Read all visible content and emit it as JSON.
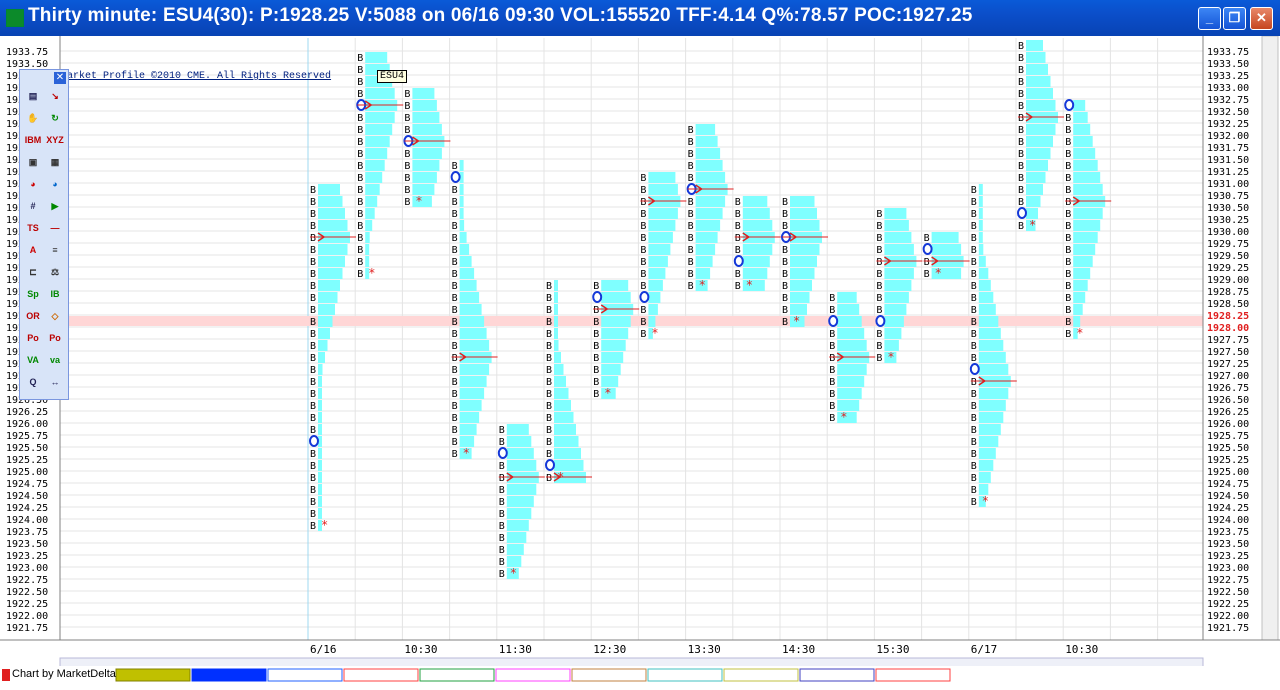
{
  "window": {
    "title": "Thirty minute: ESU4(30): P:1928.25 V:5088 on 06/16 09:30 VOL:155520 TFF:4.14 Q%:78.57 POC:1927.25",
    "min_glyph": "_",
    "max_glyph": "❐",
    "close_glyph": "✕"
  },
  "chart": {
    "copyright": "arket Profile ©2010 CME. All Rights Reserved",
    "symbol": "ESU4",
    "status": "Chart by MarketDelta",
    "toolbox_close": "✕",
    "last_price_label": "1928.25",
    "highlight_price_label": "1928.00"
  },
  "chart_data": {
    "type": "market-profile",
    "letter": "B",
    "price_labels": [
      "1933.75",
      "1933.50",
      "1933.25",
      "1933.00",
      "1932.75",
      "1932.50",
      "1932.25",
      "1932.00",
      "1931.75",
      "1931.50",
      "1931.25",
      "1931.00",
      "1930.75",
      "1930.50",
      "1930.25",
      "1930.00",
      "1929.75",
      "1929.50",
      "1929.25",
      "1929.00",
      "1928.75",
      "1928.50",
      "1928.25",
      "1928.00",
      "1927.75",
      "1927.50",
      "1927.25",
      "1927.00",
      "1926.75",
      "1926.50",
      "1926.25",
      "1926.00",
      "1925.75",
      "1925.50",
      "1925.25",
      "1925.00",
      "1924.75",
      "1924.50",
      "1924.25",
      "1924.00",
      "1923.75",
      "1923.50",
      "1923.25",
      "1923.00",
      "1922.75",
      "1922.50",
      "1922.25",
      "1922.00",
      "1921.75"
    ],
    "x_labels": [
      "6/16",
      "10:30",
      "11:30",
      "12:30",
      "13:30",
      "14:30",
      "15:30",
      "6/17",
      "10:30"
    ],
    "profiles": [
      {
        "low": 1923.75,
        "high": 1930.75,
        "open": 1925.5,
        "poc": 1929.75
      },
      {
        "low": 1929.0,
        "high": 1933.5,
        "open": 1932.5,
        "poc": 1932.5
      },
      {
        "low": 1930.5,
        "high": 1932.75,
        "open": 1931.75,
        "poc": 1931.75
      },
      {
        "low": 1925.25,
        "high": 1931.25,
        "open": 1931.0,
        "poc": 1927.25
      },
      {
        "low": 1922.75,
        "high": 1925.75,
        "open": 1925.25,
        "poc": 1924.75
      },
      {
        "low": 1924.75,
        "high": 1928.75,
        "open": 1925.0,
        "poc": 1924.75
      },
      {
        "low": 1926.5,
        "high": 1928.75,
        "open": 1928.5,
        "poc": 1928.25
      },
      {
        "low": 1927.75,
        "high": 1931.0,
        "open": 1928.5,
        "poc": 1930.5
      },
      {
        "low": 1928.75,
        "high": 1932.0,
        "open": 1930.75,
        "poc": 1930.75
      },
      {
        "low": 1928.75,
        "high": 1930.5,
        "open": 1929.25,
        "poc": 1929.75
      },
      {
        "low": 1928.0,
        "high": 1930.5,
        "open": 1929.75,
        "poc": 1929.75
      },
      {
        "low": 1926.0,
        "high": 1928.5,
        "open": 1928.0,
        "poc": 1927.25
      },
      {
        "low": 1927.25,
        "high": 1930.25,
        "open": 1928.0,
        "poc": 1929.25
      },
      {
        "low": 1929.0,
        "high": 1929.75,
        "open": 1929.5,
        "poc": 1929.25
      },
      {
        "low": 1924.25,
        "high": 1930.75,
        "open": 1927.0,
        "poc": 1926.75
      },
      {
        "low": 1930.0,
        "high": 1933.75,
        "open": 1930.25,
        "poc": 1932.25
      },
      {
        "low": 1927.75,
        "high": 1932.5,
        "open": 1932.5,
        "poc": 1930.5
      }
    ],
    "last_price": 1928.25,
    "highlight_price": 1928.0
  }
}
